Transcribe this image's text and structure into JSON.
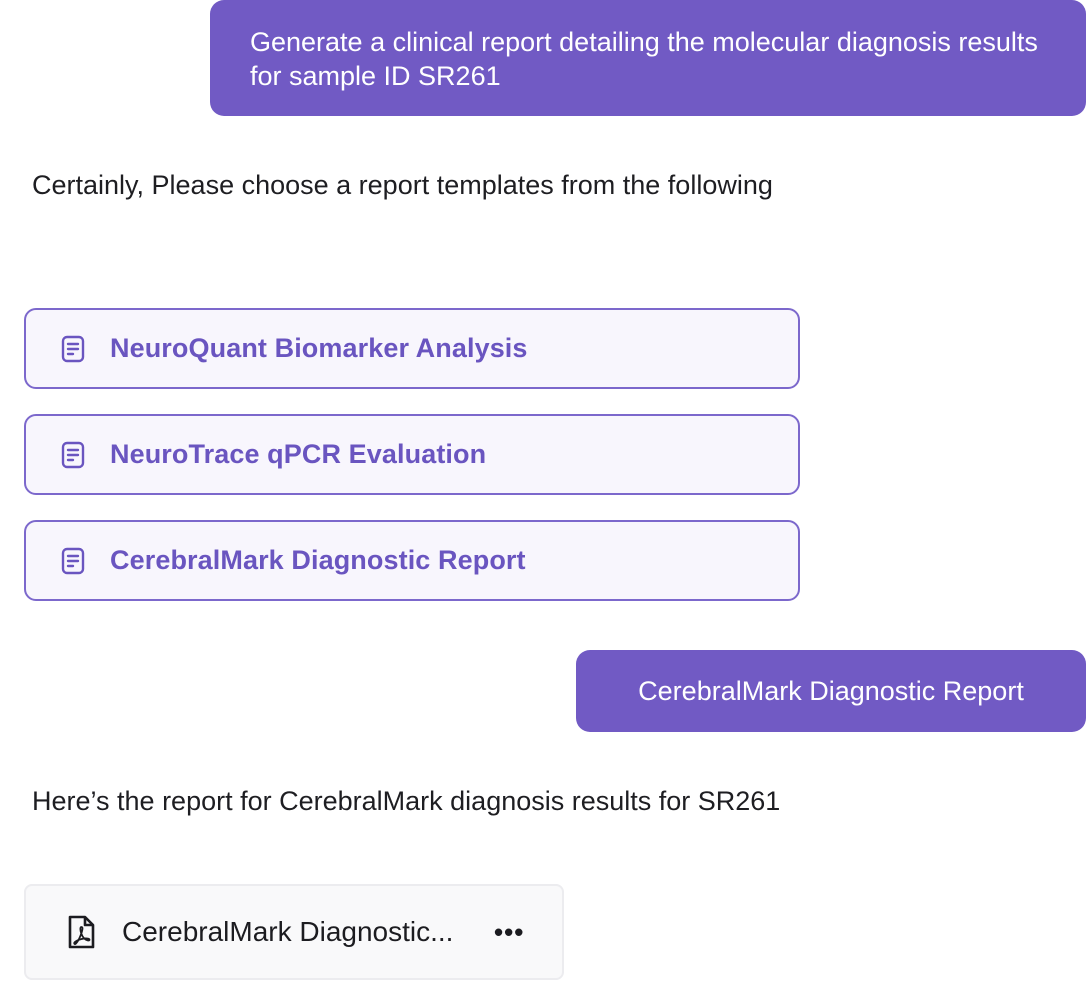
{
  "conversation": {
    "user_message_1": "Generate a clinical report detailing the molecular diagnosis results for sample ID SR261",
    "assistant_message_1": "Certainly, Please choose a report templates from the following",
    "templates": [
      {
        "label": "NeuroQuant Biomarker Analysis",
        "icon": "document-icon"
      },
      {
        "label": "NeuroTrace qPCR Evaluation",
        "icon": "document-icon"
      },
      {
        "label": "CerebralMark Diagnostic Report",
        "icon": "document-icon"
      }
    ],
    "user_message_2": "CerebralMark Diagnostic Report",
    "assistant_message_2": "Here’s the report for CerebralMark diagnosis results for SR261",
    "attachment": {
      "file_name": "CerebralMark Diagnostic...",
      "icon": "pdf-file-icon",
      "more_label": "•••"
    }
  },
  "colors": {
    "user_bubble": "#715ac4",
    "template_border": "#7c68cc",
    "template_text": "#6a55c0",
    "template_bg": "#f8f6fd"
  }
}
